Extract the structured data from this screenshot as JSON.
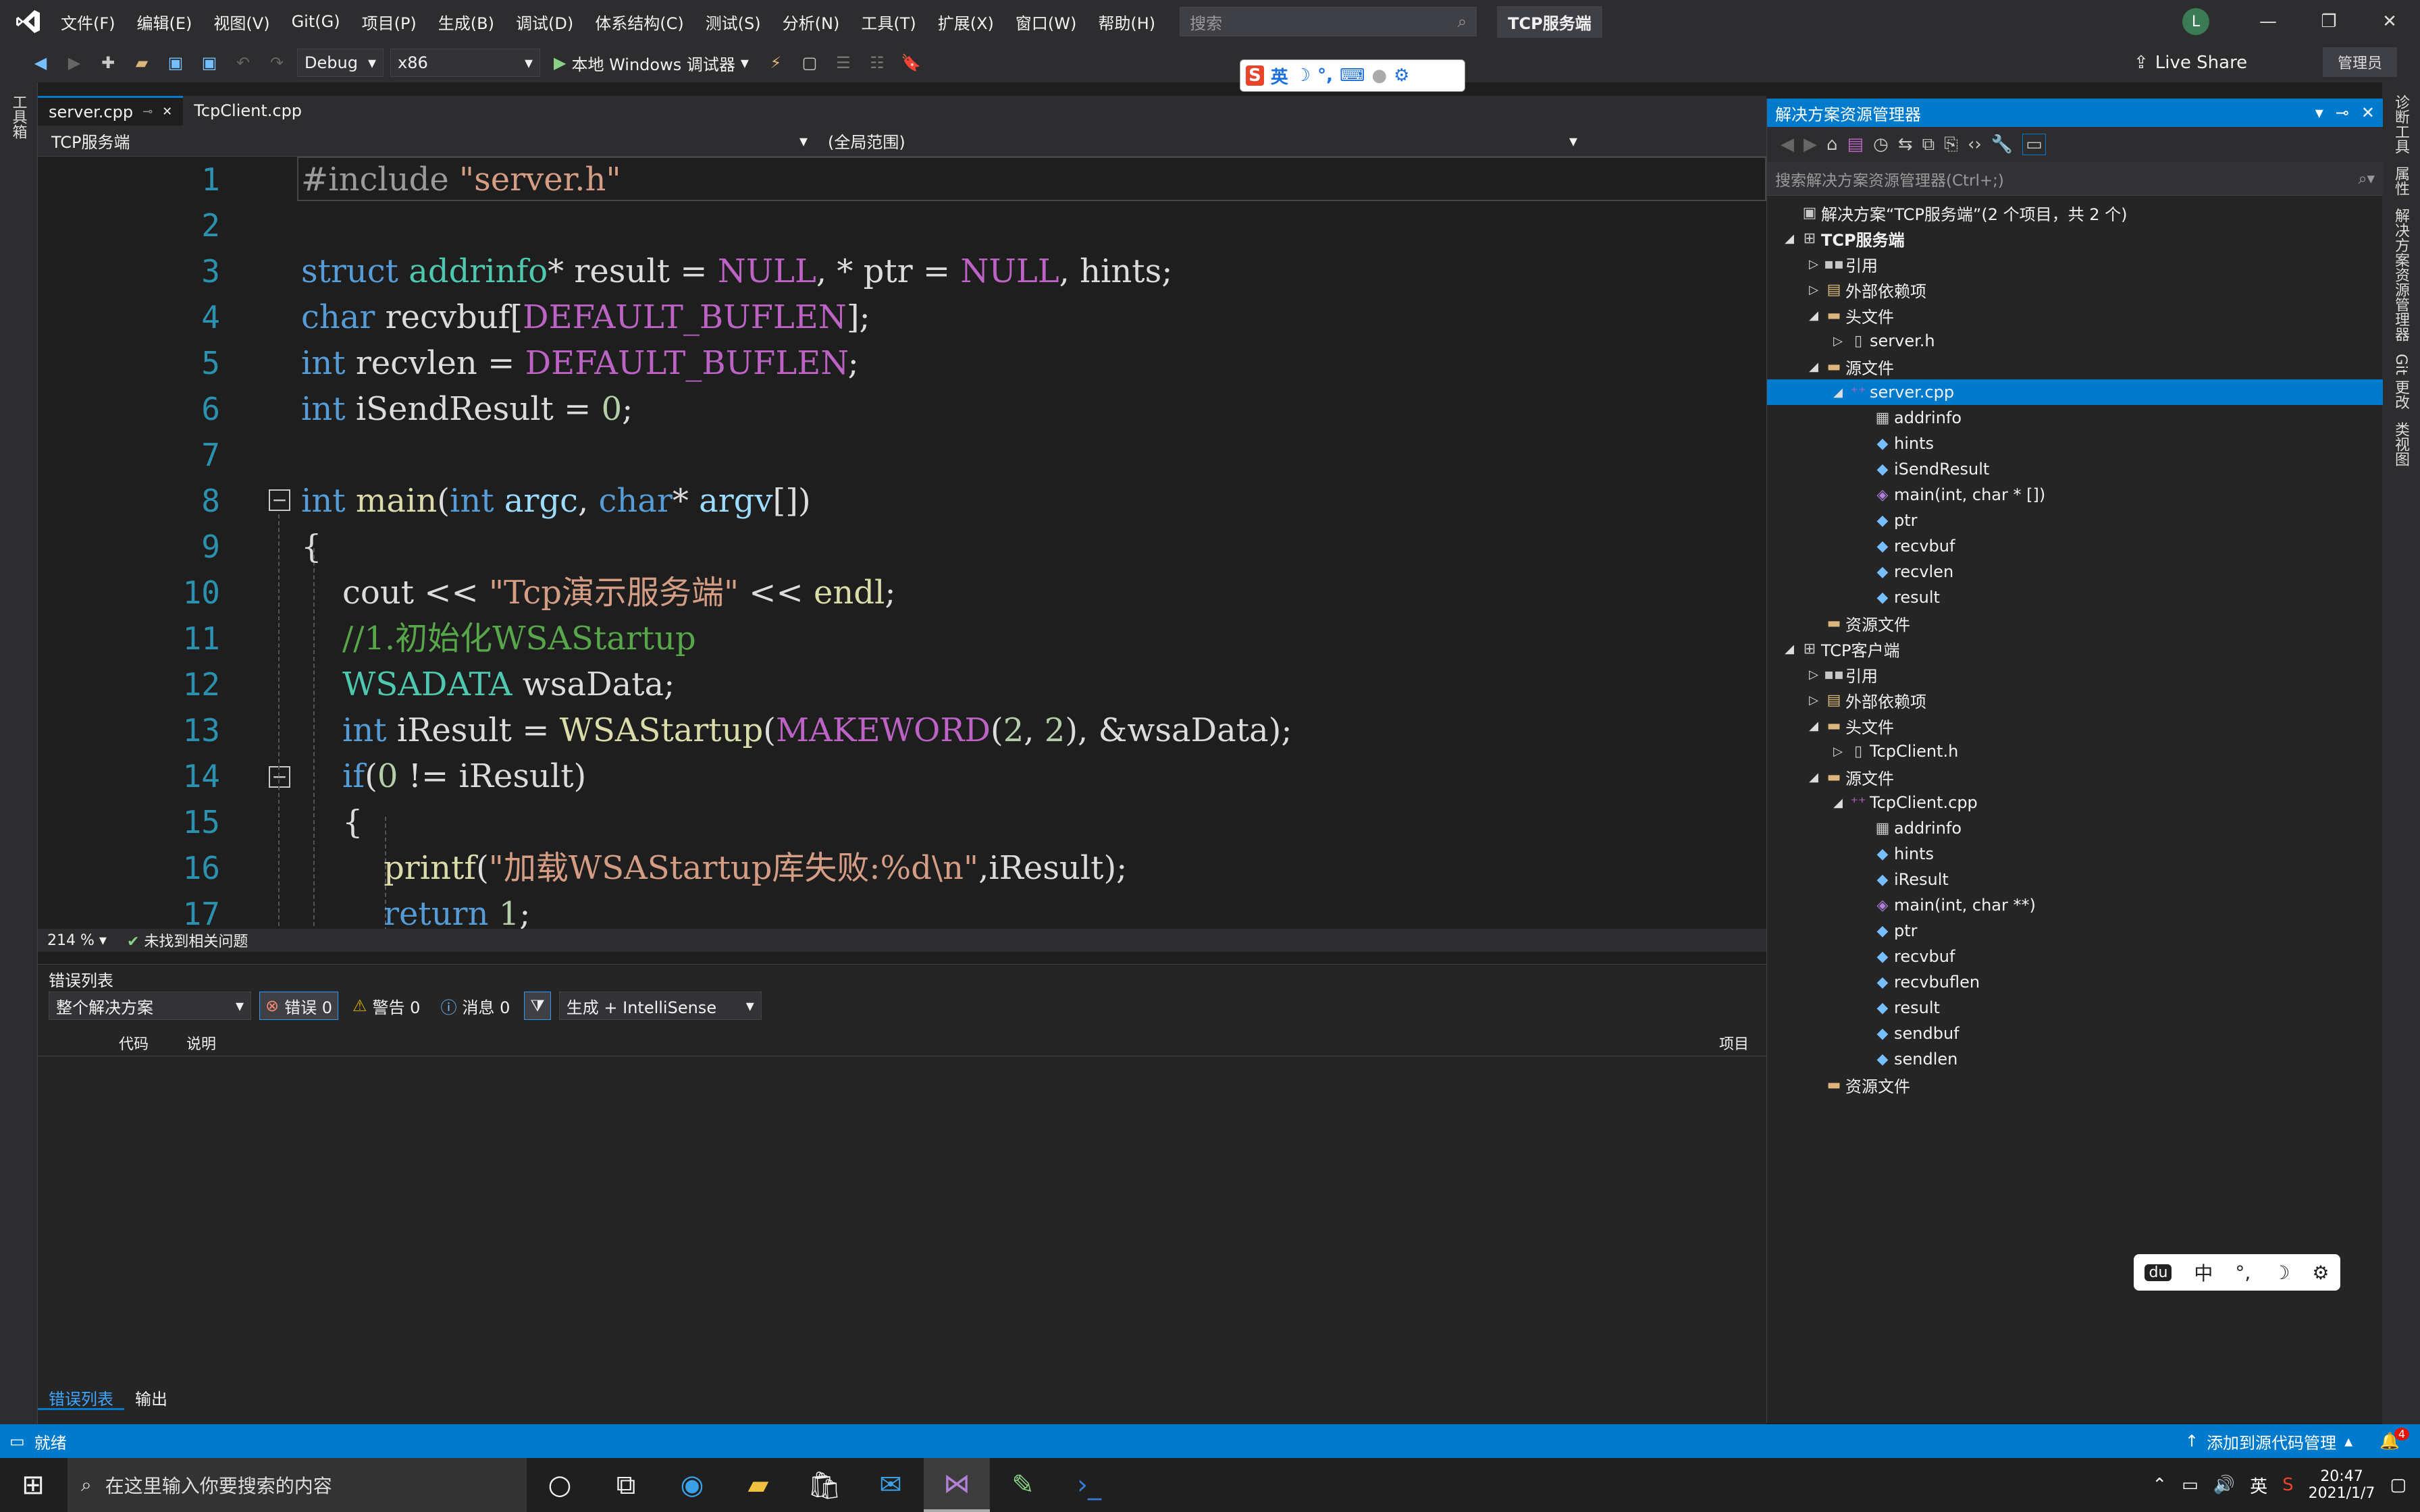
{
  "titlebar": {
    "menus": [
      "文件(F)",
      "编辑(E)",
      "视图(V)",
      "Git(G)",
      "项目(P)",
      "生成(B)",
      "调试(D)",
      "体系结构(C)",
      "测试(S)",
      "分析(N)",
      "工具(T)",
      "扩展(X)",
      "窗口(W)",
      "帮助(H)"
    ],
    "search_placeholder": "搜索",
    "solution_name": "TCP服务端",
    "avatar_letter": "L"
  },
  "toolbar": {
    "config": "Debug",
    "platform": "x86",
    "run_label": "本地 Windows 调试器",
    "live_share": "Live Share",
    "admin": "管理员"
  },
  "ime_bar": {
    "lang": "英"
  },
  "left_strip": {
    "label": "工具箱"
  },
  "right_strip": {
    "labels": [
      "诊断工具",
      "属性",
      "解决方案资源管理器",
      "Git 更改",
      "类视图"
    ]
  },
  "editor": {
    "tabs": [
      {
        "label": "server.cpp",
        "active": true
      },
      {
        "label": "TcpClient.cpp",
        "active": false
      }
    ],
    "project_combo": "TCP服务端",
    "scope_combo": "(全局范围)",
    "zoom": "214 %",
    "issues": "未找到相关问题",
    "line_numbers": [
      "1",
      "2",
      "3",
      "4",
      "5",
      "6",
      "7",
      "8",
      "9",
      "10",
      "11",
      "12",
      "13",
      "14",
      "15",
      "16",
      "17"
    ]
  },
  "error_list": {
    "title": "错误列表",
    "scope": "整个解决方案",
    "errors": "错误 0",
    "warnings": "警告 0",
    "messages": "消息 0",
    "source": "生成 + IntelliSense",
    "col_code": "代码",
    "col_desc": "说明",
    "col_project": "项目",
    "bottom_tabs": [
      "错误列表",
      "输出"
    ]
  },
  "solution_explorer": {
    "title": "解决方案资源管理器",
    "search_placeholder": "搜索解决方案资源管理器(Ctrl+;)",
    "items": [
      {
        "label": "解决方案“TCP服务端”(2 个项目，共 2 个)",
        "level": 0,
        "tw": "",
        "icon": "▣",
        "color": "#c8c8c8"
      },
      {
        "label": "TCP服务端",
        "level": 0,
        "tw": "◢",
        "icon": "⊞",
        "color": "#c8c8c8",
        "bold": true
      },
      {
        "label": "引用",
        "level": 1,
        "tw": "▷",
        "icon": "▪▪",
        "color": "#c8c8c8"
      },
      {
        "label": "外部依赖项",
        "level": 1,
        "tw": "▷",
        "icon": "▤",
        "color": "#dcb67a"
      },
      {
        "label": "头文件",
        "level": 1,
        "tw": "◢",
        "icon": "▬",
        "color": "#dcb67a"
      },
      {
        "label": "server.h",
        "level": 2,
        "tw": "▷",
        "icon": "▯",
        "color": "#c8c8c8"
      },
      {
        "label": "源文件",
        "level": 1,
        "tw": "◢",
        "icon": "▬",
        "color": "#dcb67a"
      },
      {
        "label": "server.cpp",
        "level": 2,
        "tw": "◢",
        "icon": "⁺⁺",
        "color": "#bd63c5",
        "selected": true
      },
      {
        "label": "addrinfo",
        "level": 3,
        "tw": "",
        "icon": "▦",
        "color": "#c8c8c8"
      },
      {
        "label": "hints",
        "level": 3,
        "tw": "",
        "icon": "◆",
        "color": "#75beff"
      },
      {
        "label": "iSendResult",
        "level": 3,
        "tw": "",
        "icon": "◆",
        "color": "#75beff"
      },
      {
        "label": "main(int, char * [])",
        "level": 3,
        "tw": "",
        "icon": "◈",
        "color": "#b180d7"
      },
      {
        "label": "ptr",
        "level": 3,
        "tw": "",
        "icon": "◆",
        "color": "#75beff"
      },
      {
        "label": "recvbuf",
        "level": 3,
        "tw": "",
        "icon": "◆",
        "color": "#75beff"
      },
      {
        "label": "recvlen",
        "level": 3,
        "tw": "",
        "icon": "◆",
        "color": "#75beff"
      },
      {
        "label": "result",
        "level": 3,
        "tw": "",
        "icon": "◆",
        "color": "#75beff"
      },
      {
        "label": "资源文件",
        "level": 1,
        "tw": "",
        "icon": "▬",
        "color": "#dcb67a"
      },
      {
        "label": "TCP客户端",
        "level": 0,
        "tw": "◢",
        "icon": "⊞",
        "color": "#c8c8c8"
      },
      {
        "label": "引用",
        "level": 1,
        "tw": "▷",
        "icon": "▪▪",
        "color": "#c8c8c8"
      },
      {
        "label": "外部依赖项",
        "level": 1,
        "tw": "▷",
        "icon": "▤",
        "color": "#dcb67a"
      },
      {
        "label": "头文件",
        "level": 1,
        "tw": "◢",
        "icon": "▬",
        "color": "#dcb67a"
      },
      {
        "label": "TcpClient.h",
        "level": 2,
        "tw": "▷",
        "icon": "▯",
        "color": "#c8c8c8"
      },
      {
        "label": "源文件",
        "level": 1,
        "tw": "◢",
        "icon": "▬",
        "color": "#dcb67a"
      },
      {
        "label": "TcpClient.cpp",
        "level": 2,
        "tw": "◢",
        "icon": "⁺⁺",
        "color": "#bd63c5"
      },
      {
        "label": "addrinfo",
        "level": 3,
        "tw": "",
        "icon": "▦",
        "color": "#c8c8c8"
      },
      {
        "label": "hints",
        "level": 3,
        "tw": "",
        "icon": "◆",
        "color": "#75beff"
      },
      {
        "label": "iResult",
        "level": 3,
        "tw": "",
        "icon": "◆",
        "color": "#75beff"
      },
      {
        "label": "main(int, char **)",
        "level": 3,
        "tw": "",
        "icon": "◈",
        "color": "#b180d7"
      },
      {
        "label": "ptr",
        "level": 3,
        "tw": "",
        "icon": "◆",
        "color": "#75beff"
      },
      {
        "label": "recvbuf",
        "level": 3,
        "tw": "",
        "icon": "◆",
        "color": "#75beff"
      },
      {
        "label": "recvbuflen",
        "level": 3,
        "tw": "",
        "icon": "◆",
        "color": "#75beff"
      },
      {
        "label": "result",
        "level": 3,
        "tw": "",
        "icon": "◆",
        "color": "#75beff"
      },
      {
        "label": "sendbuf",
        "level": 3,
        "tw": "",
        "icon": "◆",
        "color": "#75beff"
      },
      {
        "label": "sendlen",
        "level": 3,
        "tw": "",
        "icon": "◆",
        "color": "#75beff"
      },
      {
        "label": "资源文件",
        "level": 1,
        "tw": "",
        "icon": "▬",
        "color": "#dcb67a"
      }
    ]
  },
  "statusbar": {
    "left": "就绪",
    "source_control": "添加到源代码管理",
    "notify_count": "4"
  },
  "taskbar": {
    "search_placeholder": "在这里输入你要搜索的内容",
    "ime": "英",
    "time": "20:47",
    "date": "2021/1/7"
  },
  "ime_float": {
    "lang": "中",
    "punct": "°,"
  },
  "colors": {
    "accent": "#007acc",
    "keyword": "#569cd6",
    "string": "#d69d85",
    "comment": "#57a64a",
    "macro": "#bd63c5"
  }
}
